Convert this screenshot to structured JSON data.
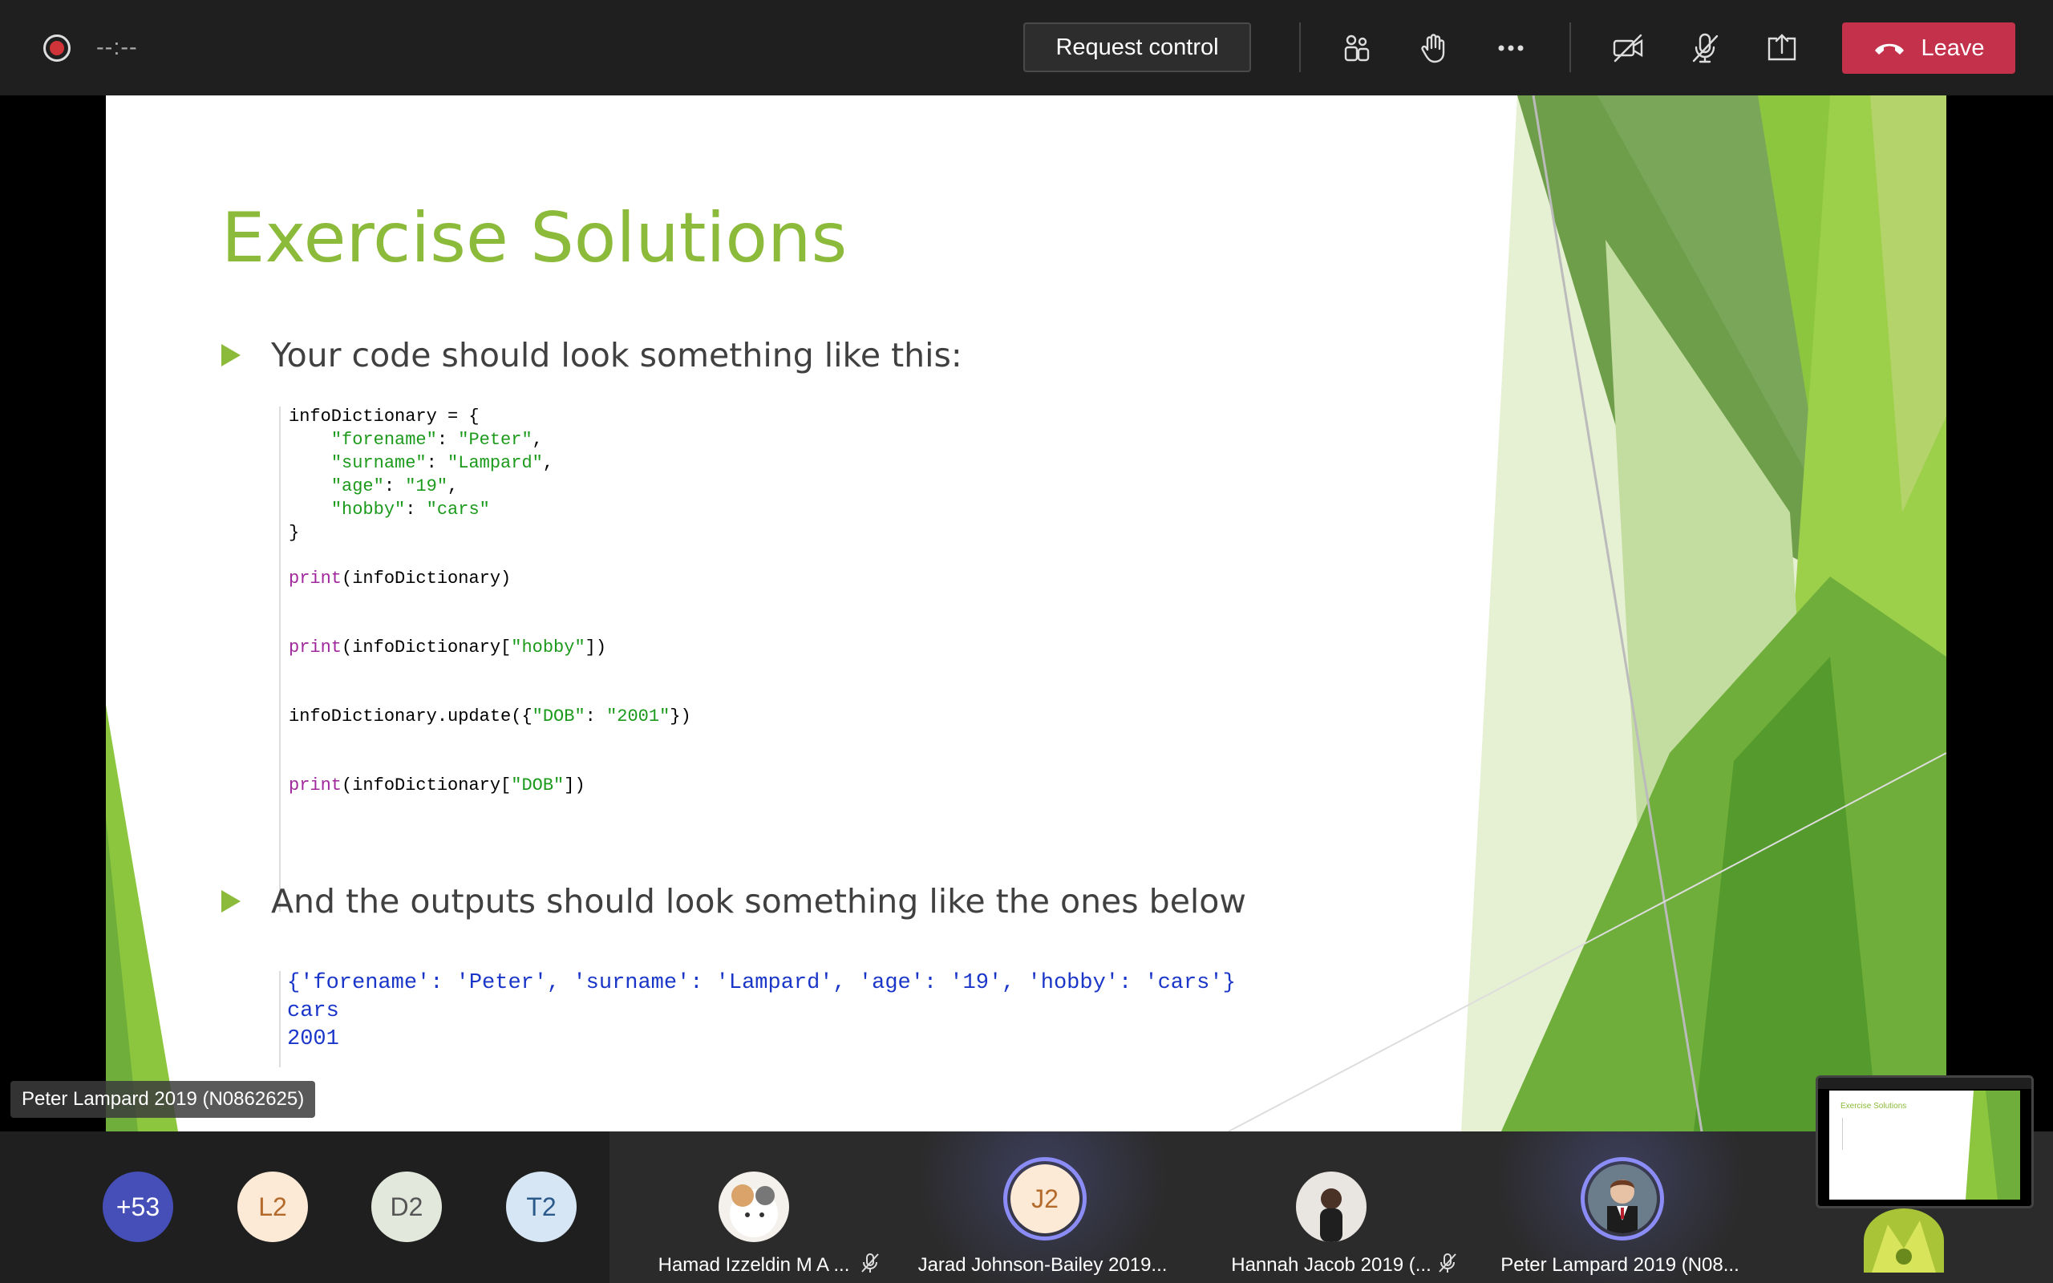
{
  "topbar": {
    "timer": "--:--",
    "request_control_label": "Request control",
    "leave_label": "Leave",
    "icons": [
      "record-icon",
      "people-icon",
      "raise-hand-icon",
      "more-icon",
      "camera-off-icon",
      "mic-off-icon",
      "share-icon",
      "phone-hangup-icon"
    ]
  },
  "slide": {
    "title": "Exercise Solutions",
    "bullet1": "Your code should look something like this:",
    "bullet2": "And the outputs should look something like the ones below",
    "code": {
      "line1": "infoDictionary = {",
      "line2_key": "\"forename\"",
      "line2_val": "\"Peter\"",
      "line3_key": "\"surname\"",
      "line3_val": "\"Lampard\"",
      "line4_key": "\"age\"",
      "line4_val": "\"19\"",
      "line5_key": "\"hobby\"",
      "line5_val": "\"cars\"",
      "line6": "}",
      "print_kw": "print",
      "line7_rest": "(infoDictionary)",
      "line8_pre": "(infoDictionary[",
      "line8_str": "\"hobby\"",
      "line8_post": "])",
      "line9_pre": "infoDictionary.update({",
      "line9_str1": "\"DOB\"",
      "line9_str2": "\"2001\"",
      "line9_post": "})",
      "line10_pre": "(infoDictionary[",
      "line10_str": "\"DOB\"",
      "line10_post": "])"
    },
    "output": {
      "line1": "{'forename': 'Peter', 'surname': 'Lampard', 'age': '19', 'hobby': 'cars'}",
      "line2": "cars",
      "line3": "2001"
    },
    "presenter_label": "Peter Lampard 2019 (N0862625)"
  },
  "participants": {
    "overflow": "+53",
    "avatars": [
      {
        "initials": "L2",
        "bg": "#fce9d6",
        "fg": "#b36a2a"
      },
      {
        "initials": "D2",
        "bg": "#e3e8dd",
        "fg": "#555"
      },
      {
        "initials": "T2",
        "bg": "#d7e6f5",
        "fg": "#2b5a8a"
      }
    ],
    "tiles": [
      {
        "name": "Hamad Izzeldin M A ...",
        "muted": true
      },
      {
        "name": "Jarad Johnson-Bailey 2019...",
        "initials": "J2",
        "speaking": true
      },
      {
        "name": "Hannah Jacob 2019 (...",
        "muted": true
      },
      {
        "name": "Peter Lampard 2019 (N08...",
        "speaking": true
      }
    ]
  },
  "pip": {
    "mini_title": "Exercise Solutions"
  },
  "colors": {
    "accent_green": "#8cba3a",
    "leave_red": "#c4314b",
    "speaking_ring": "#8b8cf5"
  }
}
